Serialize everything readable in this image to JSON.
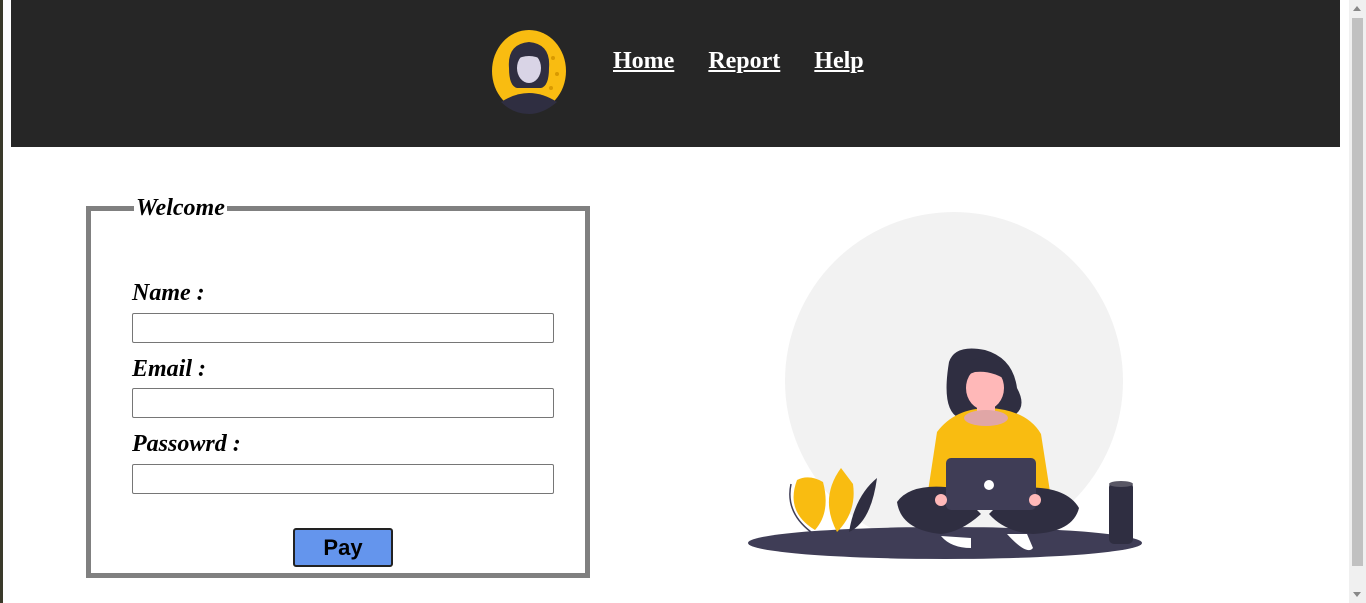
{
  "header": {
    "nav": [
      "Home",
      "Report",
      "Help"
    ]
  },
  "form": {
    "legend": "Welcome",
    "name_label": "Name :",
    "email_label": "Email :",
    "password_label": "Passowrd :",
    "name_value": "",
    "email_value": "",
    "password_value": "",
    "submit_label": "Pay"
  },
  "colors": {
    "header_bg": "#262626",
    "accent_yellow": "#f9bc11",
    "button_blue": "#6495ed",
    "fieldset_border": "#808080"
  },
  "icons": {
    "logo": "woman-avatar-icon",
    "illustration": "woman-with-laptop-illustration"
  }
}
